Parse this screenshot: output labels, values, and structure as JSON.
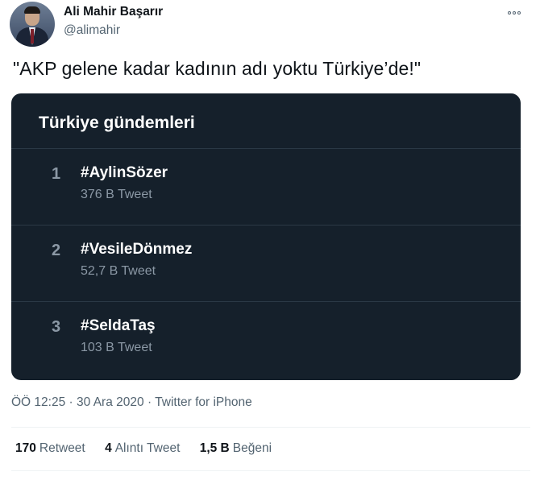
{
  "user": {
    "name": "Ali Mahir Başarır",
    "handle": "@alimahir"
  },
  "tweet": {
    "text": "\"AKP gelene kadar kadının adı yoktu Türkiye’de!\"",
    "time": "ÖÖ 12:25",
    "date": "30 Ara 2020",
    "source": "Twitter for iPhone",
    "meta_separator": "·"
  },
  "trends_card": {
    "title": "Türkiye gündemleri",
    "items": [
      {
        "rank": "1",
        "hashtag": "#AylinSözer",
        "count": "376 B Tweet"
      },
      {
        "rank": "2",
        "hashtag": "#VesileDönmez",
        "count": "52,7 B Tweet"
      },
      {
        "rank": "3",
        "hashtag": "#SeldaTaş",
        "count": "103 B Tweet"
      }
    ]
  },
  "stats": {
    "retweets": {
      "value": "170",
      "label": "Retweet"
    },
    "quotes": {
      "value": "4",
      "label": "Alıntı Tweet"
    },
    "likes": {
      "value": "1,5 B",
      "label": "Beğeni"
    }
  },
  "icons": {
    "more": "more-horizontal-icon"
  }
}
